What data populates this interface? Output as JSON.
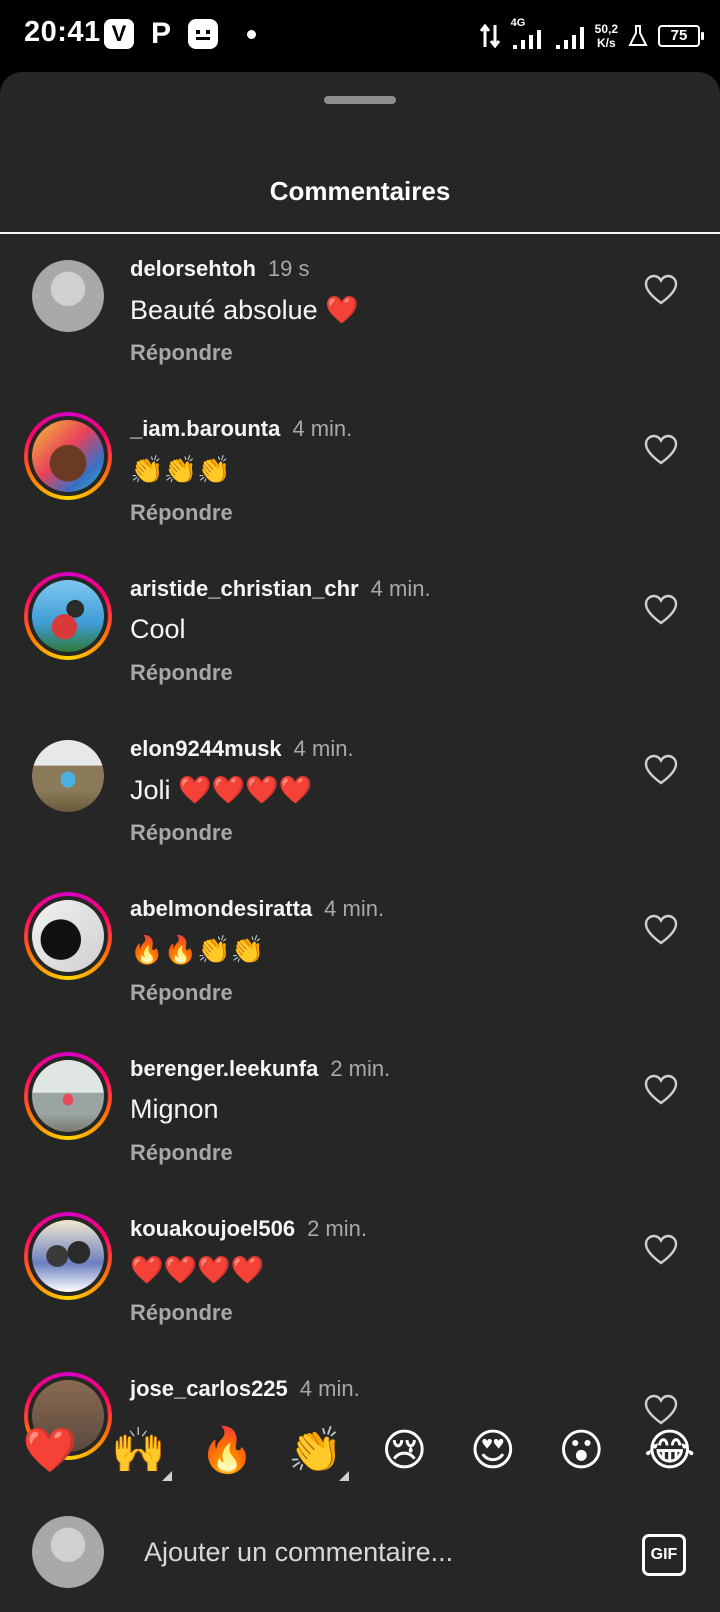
{
  "status_bar": {
    "time": "20:41",
    "app_icons": [
      "V",
      "P"
    ],
    "network": "4G",
    "speed_value": "50,2",
    "speed_unit": "K/s",
    "battery": "75"
  },
  "sheet": {
    "title": "Commentaires"
  },
  "comments": [
    {
      "username": "delorsehtoh",
      "time": "19 s",
      "text": "Beauté absolue ❤️",
      "reply": "Répondre",
      "ring": false,
      "avatar_color": "#b9b9b9"
    },
    {
      "username": "_iam.barounta",
      "time": "4 min.",
      "text": "👏👏👏",
      "reply": "Répondre",
      "ring": true,
      "avatar_color": "#3a6fc4"
    },
    {
      "username": "aristide_christian_chr",
      "time": "4 min.",
      "text": "Cool",
      "reply": "Répondre",
      "ring": true,
      "avatar_color": "#4aa0d6"
    },
    {
      "username": "elon9244musk",
      "time": "4 min.",
      "text": "Joli ❤️❤️❤️❤️",
      "reply": "Répondre",
      "ring": false,
      "avatar_color": "#8a7a5a"
    },
    {
      "username": "abelmondesiratta",
      "time": "4 min.",
      "text": "🔥🔥👏👏",
      "reply": "Répondre",
      "ring": true,
      "avatar_color": "#d8d8d8"
    },
    {
      "username": "berenger.leekunfa",
      "time": "2 min.",
      "text": "Mignon",
      "reply": "Répondre",
      "ring": true,
      "avatar_color": "#9aa4a0"
    },
    {
      "username": "kouakoujoel506",
      "time": "2 min.",
      "text": "❤️❤️❤️❤️",
      "reply": "Répondre",
      "ring": true,
      "avatar_color": "#6b7fc0"
    },
    {
      "username": "jose_carlos225",
      "time": "4 min.",
      "text": "",
      "reply": "",
      "ring": true,
      "avatar_color": "#5a4a40"
    }
  ],
  "emoji_bar": [
    "❤️",
    "🙌",
    "🔥",
    "👏",
    "😢",
    "😍",
    "😮",
    "😂"
  ],
  "input": {
    "placeholder": "Ajouter un commentaire...",
    "gif_label": "GIF"
  }
}
